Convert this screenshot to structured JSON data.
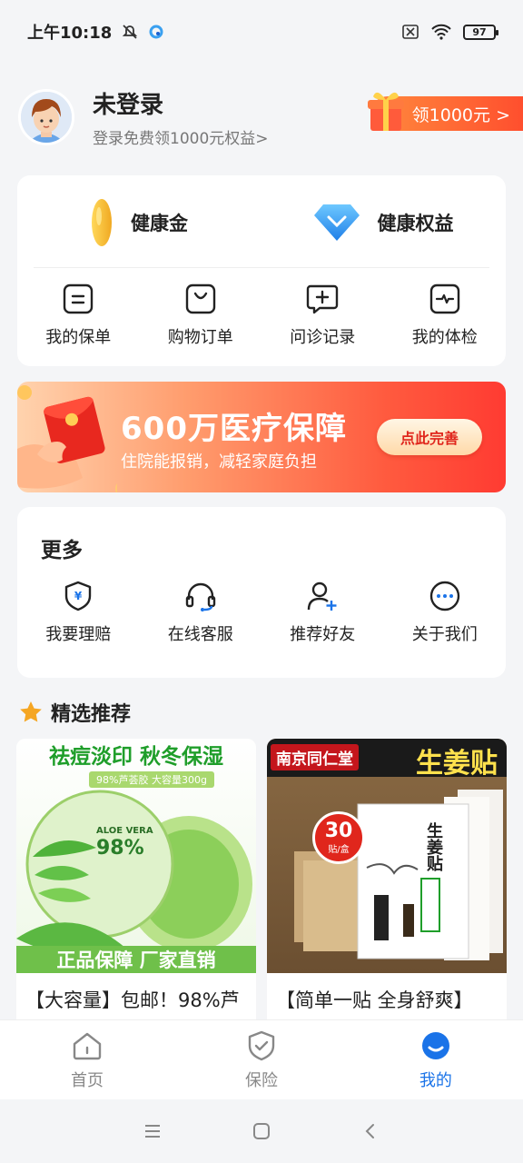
{
  "status": {
    "time": "上午10:18",
    "battery": "97"
  },
  "profile": {
    "name": "未登录",
    "subtitle": "登录免费领1000元权益>",
    "reward": "领1000元 >"
  },
  "health": {
    "gold_label": "健康金",
    "benefit_label": "健康权益"
  },
  "services": [
    {
      "label": "我的保单",
      "icon": "policy-icon"
    },
    {
      "label": "购物订单",
      "icon": "shopping-bag-icon"
    },
    {
      "label": "问诊记录",
      "icon": "consultation-icon"
    },
    {
      "label": "我的体检",
      "icon": "checkup-icon"
    }
  ],
  "banner": {
    "title": "600万医疗保障",
    "subtitle": "住院能报销，减轻家庭负担",
    "button": "点此完善"
  },
  "more": {
    "title": "更多",
    "items": [
      {
        "label": "我要理赔",
        "icon": "claim-shield-icon"
      },
      {
        "label": "在线客服",
        "icon": "headset-icon"
      },
      {
        "label": "推荐好友",
        "icon": "add-friend-icon"
      },
      {
        "label": "关于我们",
        "icon": "more-dots-icon"
      }
    ]
  },
  "recommend": {
    "title": "精选推荐",
    "products": [
      {
        "caption": "【大容量】包邮！98%芦",
        "img_top": "祛痘淡印  秋冬保湿",
        "img_tag": "98%芦荟胶 大容量300g",
        "img_bottom": "正品保障  厂家直销",
        "img_brand": "ALOE VERA",
        "img_percent": "98%"
      },
      {
        "caption": "【简单一贴 全身舒爽】",
        "img_brand": "南京同仁堂",
        "img_title": "生姜贴",
        "img_count": "30",
        "img_count_unit": "贴/盒",
        "img_box_text": "生姜贴"
      }
    ]
  },
  "tabs": [
    {
      "label": "首页",
      "icon": "home-icon",
      "active": false
    },
    {
      "label": "保险",
      "icon": "insurance-shield-icon",
      "active": false
    },
    {
      "label": "我的",
      "icon": "profile-icon",
      "active": true
    }
  ],
  "colors": {
    "accent": "#1a73e8",
    "banner_red": "#ff3b32",
    "reward_orange": "#ff6a33"
  }
}
